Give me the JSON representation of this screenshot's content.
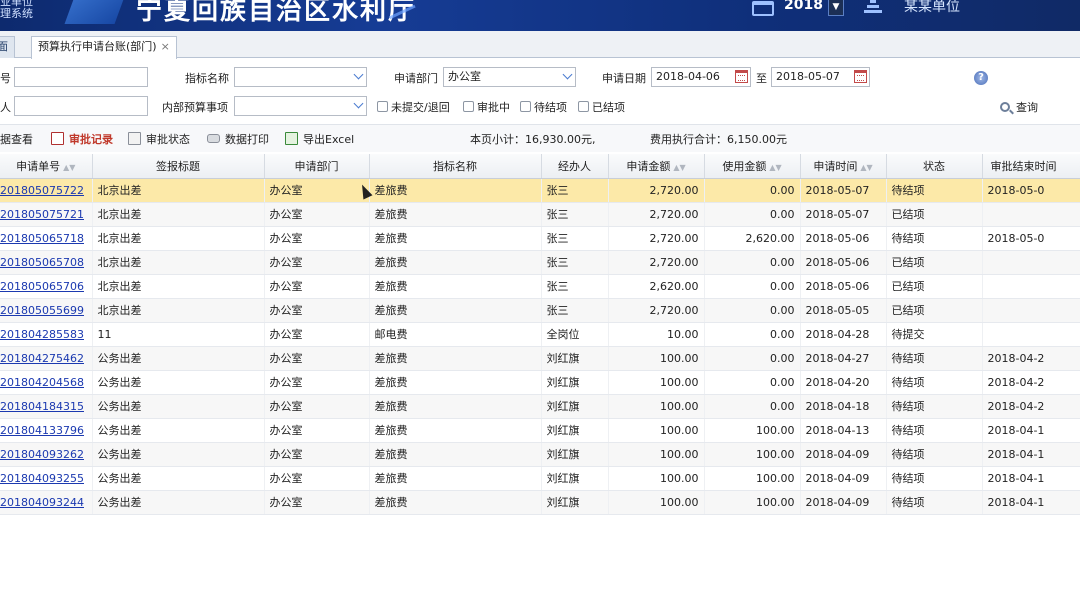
{
  "header": {
    "system_name": "业单位\n理系统",
    "title": "宁夏回族自治区水利厅",
    "year": "2018",
    "unit": "某某单位"
  },
  "tabs": [
    {
      "label": "桌面",
      "visible": "面",
      "active": false
    },
    {
      "label": "预算执行申请台账(部门)",
      "active": true
    }
  ],
  "filters": {
    "apply_no_label": "号",
    "handler_label": "人",
    "indicator_label": "指标名称",
    "internal_item_label": "内部预算事项",
    "apply_dept_label": "申请部门",
    "apply_dept_value": "办公室",
    "apply_date_label": "申请日期",
    "date_from": "2018-04-06",
    "date_to_label": "至",
    "date_to": "2018-05-07",
    "status_options": [
      "未提交/退回",
      "审批中",
      "待结项",
      "已结项"
    ],
    "search_label": "查询"
  },
  "toolbar": {
    "items": [
      "据查看",
      "审批记录",
      "审批状态",
      "数据打印",
      "导出Excel"
    ],
    "page_subtotal": "本页小计：16,930.00元,",
    "expense_total": "费用执行合计：6,150.00元"
  },
  "table": {
    "columns": [
      "申请单号",
      "签报标题",
      "申请部门",
      "指标名称",
      "经办人",
      "申请金额",
      "使用金额",
      "申请时间",
      "状态",
      "审批结束时间"
    ],
    "rows": [
      [
        "201805075722",
        "北京出差",
        "办公室",
        "差旅费",
        "张三",
        "2,720.00",
        "0.00",
        "2018-05-07",
        "待结项",
        "2018-05-0"
      ],
      [
        "201805075721",
        "北京出差",
        "办公室",
        "差旅费",
        "张三",
        "2,720.00",
        "0.00",
        "2018-05-07",
        "已结项",
        ""
      ],
      [
        "201805065718",
        "北京出差",
        "办公室",
        "差旅费",
        "张三",
        "2,720.00",
        "2,620.00",
        "2018-05-06",
        "待结项",
        "2018-05-0"
      ],
      [
        "201805065708",
        "北京出差",
        "办公室",
        "差旅费",
        "张三",
        "2,720.00",
        "0.00",
        "2018-05-06",
        "已结项",
        ""
      ],
      [
        "201805065706",
        "北京出差",
        "办公室",
        "差旅费",
        "张三",
        "2,620.00",
        "0.00",
        "2018-05-06",
        "已结项",
        ""
      ],
      [
        "201805055699",
        "北京出差",
        "办公室",
        "差旅费",
        "张三",
        "2,720.00",
        "0.00",
        "2018-05-05",
        "已结项",
        ""
      ],
      [
        "201804285583",
        "11",
        "办公室",
        "邮电费",
        "全岗位",
        "10.00",
        "0.00",
        "2018-04-28",
        "待提交",
        ""
      ],
      [
        "201804275462",
        "公务出差",
        "办公室",
        "差旅费",
        "刘红旗",
        "100.00",
        "0.00",
        "2018-04-27",
        "待结项",
        "2018-04-2"
      ],
      [
        "201804204568",
        "公务出差",
        "办公室",
        "差旅费",
        "刘红旗",
        "100.00",
        "0.00",
        "2018-04-20",
        "待结项",
        "2018-04-2"
      ],
      [
        "201804184315",
        "公务出差",
        "办公室",
        "差旅费",
        "刘红旗",
        "100.00",
        "0.00",
        "2018-04-18",
        "待结项",
        "2018-04-2"
      ],
      [
        "201804133796",
        "公务出差",
        "办公室",
        "差旅费",
        "刘红旗",
        "100.00",
        "100.00",
        "2018-04-13",
        "待结项",
        "2018-04-1"
      ],
      [
        "201804093262",
        "公务出差",
        "办公室",
        "差旅费",
        "刘红旗",
        "100.00",
        "100.00",
        "2018-04-09",
        "待结项",
        "2018-04-1"
      ],
      [
        "201804093255",
        "公务出差",
        "办公室",
        "差旅费",
        "刘红旗",
        "100.00",
        "100.00",
        "2018-04-09",
        "待结项",
        "2018-04-1"
      ],
      [
        "201804093244",
        "公务出差",
        "办公室",
        "差旅费",
        "刘红旗",
        "100.00",
        "100.00",
        "2018-04-09",
        "待结项",
        "2018-04-1"
      ]
    ]
  }
}
